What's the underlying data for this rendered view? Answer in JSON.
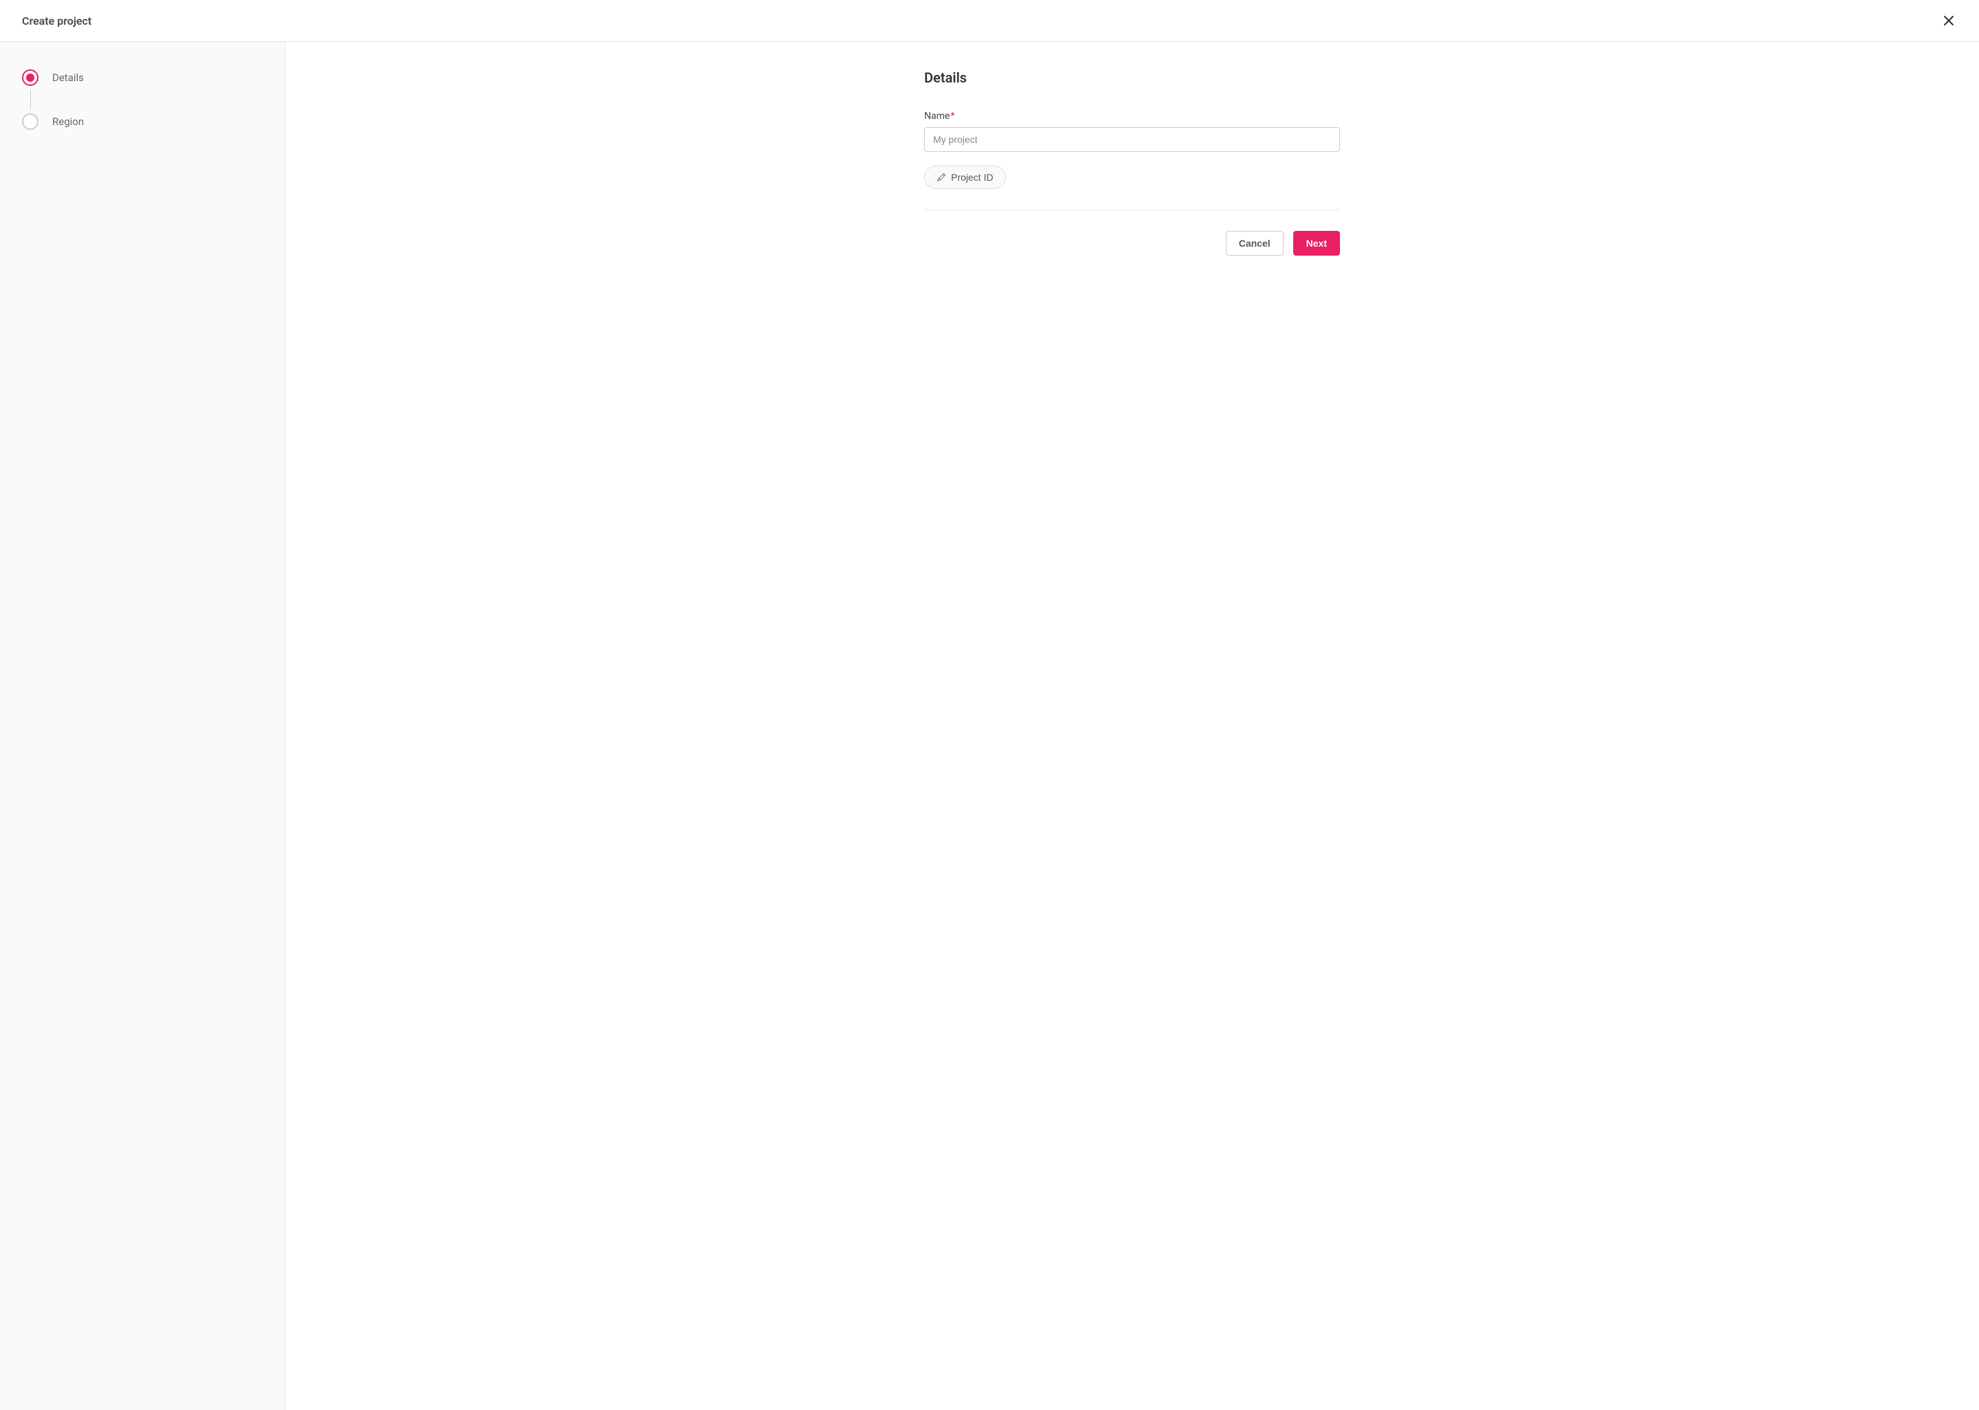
{
  "header": {
    "title": "Create project"
  },
  "sidebar": {
    "steps": [
      {
        "label": "Details",
        "active": true
      },
      {
        "label": "Region",
        "active": false
      }
    ]
  },
  "main": {
    "section_title": "Details",
    "name_label": "Name",
    "name_placeholder": "My project",
    "name_value": "",
    "project_id_label": "Project ID"
  },
  "actions": {
    "cancel": "Cancel",
    "next": "Next"
  },
  "colors": {
    "accent": "#e91e63"
  }
}
